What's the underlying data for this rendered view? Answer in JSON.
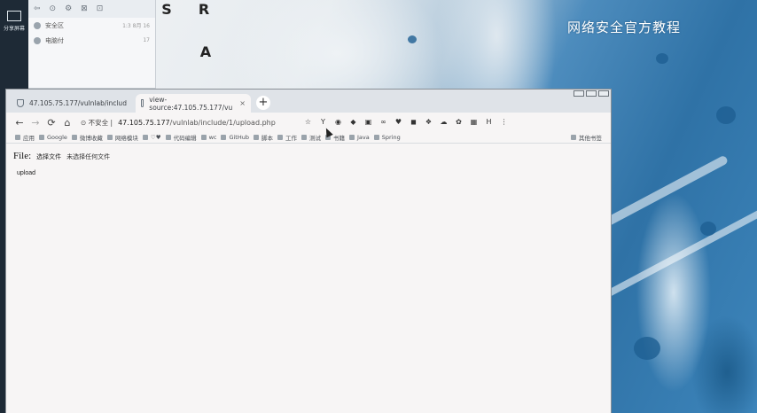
{
  "desktop": {
    "watermark": "网络安全官方教程",
    "left_strip_label": "分享屏幕",
    "chat": {
      "title_icons": [
        "⇦",
        "⊙",
        "⚙",
        "⊠",
        "⊡"
      ],
      "rows": [
        {
          "label": "安全区",
          "meta": "1:3 8月 16"
        },
        {
          "label": "电脑付",
          "meta": "17"
        }
      ]
    },
    "icons": [
      {
        "name": "shortcut-s",
        "glyph": "S",
        "label": ""
      },
      {
        "name": "shortcut-r",
        "glyph": "R",
        "label": ""
      },
      {
        "name": "shortcut-a",
        "glyph": "A",
        "label": ""
      }
    ]
  },
  "browser": {
    "tabs": [
      {
        "label": "47.105.75.177/vulnlab/includ",
        "active": false
      },
      {
        "label": "view-source:47.105.75.177/vu",
        "active": true
      }
    ],
    "new_tab": "+",
    "nav": {
      "back": "←",
      "forward": "→",
      "reload": "⟳",
      "home": "⌂",
      "site_info": "⊙ 不安全 |",
      "url_host": "47.105.75.177",
      "url_path": "/vulnlab/include/1/upload.php"
    },
    "extensions": [
      "☆",
      "Y",
      "◉",
      "◆",
      "▣",
      "∞",
      "♥",
      "◼",
      "❖",
      "☁",
      "✿",
      "▦",
      "H",
      "⋮"
    ],
    "bookmarks": [
      {
        "label": "应用"
      },
      {
        "label": "Google"
      },
      {
        "label": "微博收藏"
      },
      {
        "label": "网络模块"
      },
      {
        "label": "♡♥"
      },
      {
        "label": "代码编辑"
      },
      {
        "label": "wc"
      },
      {
        "label": "GitHub"
      },
      {
        "label": "脚本"
      },
      {
        "label": "工作"
      },
      {
        "label": "测试"
      },
      {
        "label": "书籍"
      },
      {
        "label": "Java"
      },
      {
        "label": "Spring"
      }
    ],
    "bookmarks_right": "其他书签",
    "page": {
      "file_label": "File:",
      "choose_button": "选择文件",
      "no_file": "未选择任何文件",
      "upload_button": "upload"
    }
  }
}
